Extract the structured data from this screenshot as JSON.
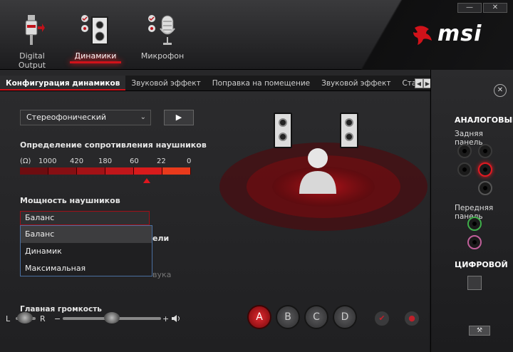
{
  "window": {
    "minimize": "—",
    "close": "✕"
  },
  "devices": [
    {
      "label": "Digital Output"
    },
    {
      "label": "Динамики"
    },
    {
      "label": "Микрофон"
    }
  ],
  "logo": {
    "text": "msi"
  },
  "tabs": [
    "Конфигурация динамиков",
    "Звуковой эффект",
    "Поправка на помещение",
    "Звуковой эффект",
    "Стандартны"
  ],
  "config": {
    "selected": "Стереофонический",
    "play": "▶"
  },
  "impedance": {
    "title": "Определение сопротивления наушников",
    "unit": "(Ω)",
    "scale": [
      "1000",
      "420",
      "180",
      "60",
      "22",
      "0"
    ],
    "selected_index": 4,
    "colors": [
      "#6d0d10",
      "#860f13",
      "#a31216",
      "#c0161a",
      "#d81b1c",
      "#e83a1c"
    ]
  },
  "power": {
    "title": "Мощность наушников",
    "selected": "Баланс",
    "options": [
      "Баланс",
      "Динамик",
      "Максимальная"
    ],
    "hidden_fragment": "ели",
    "hidden_fragment2": "вука"
  },
  "volume": {
    "label": "Главная громкость",
    "left": "L",
    "right": "R",
    "minus": "−",
    "plus": "+"
  },
  "devices_abcd": [
    "A",
    "B",
    "C",
    "D"
  ],
  "right": {
    "analog": "АНАЛОГОВЫЙ",
    "rear": "Задняя панель",
    "front": "Передняя панель",
    "digital": "ЦИФРОВОЙ"
  },
  "colors": {
    "accent": "#d0121a",
    "active_jack": "#e01a22",
    "green_jack": "#3fae4a",
    "pink_jack": "#c0609a"
  }
}
